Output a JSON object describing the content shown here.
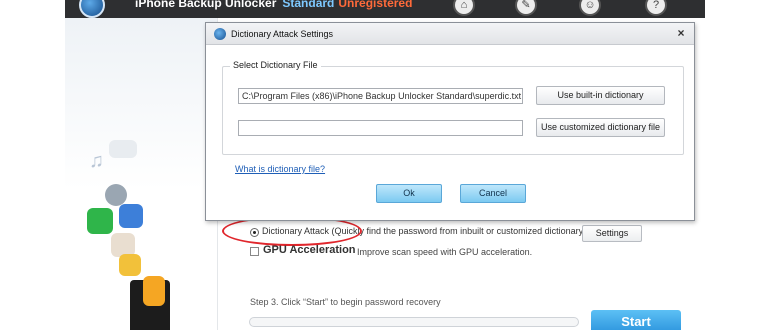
{
  "app": {
    "title": "iPhone Backup Unlocker",
    "edition": "Standard",
    "registration": "Unregistered",
    "top_icons": [
      "home-icon",
      "tools-icon",
      "user-icon",
      "help-icon"
    ]
  },
  "dialog": {
    "title": "Dictionary Attack Settings",
    "close_label": "×",
    "group_label": "Select Dictionary File",
    "path_value": "C:\\Program Files (x86)\\iPhone Backup Unlocker Standard\\superdic.txt",
    "custom_path_value": "",
    "builtin_button": "Use built-in dictionary",
    "custom_button": "Use customized dictionary file",
    "help_link": "What is dictionary file?",
    "ok_button": "Ok",
    "cancel_button": "Cancel"
  },
  "main": {
    "attack_option": "Dictionary Attack (Quickly find the password from inbuilt or customized dictionary)",
    "settings_button": "Settings",
    "gpu_title": "GPU Acceleration",
    "gpu_desc": "Improve scan speed with GPU acceleration.",
    "step3": "Step 3. Click “Start” to begin password recovery",
    "progress_percent": 0,
    "start_button": "Start"
  },
  "colors": {
    "accent": "#2b93dc",
    "highlight_ellipse": "#e0262c",
    "link": "#1f5fb7"
  }
}
